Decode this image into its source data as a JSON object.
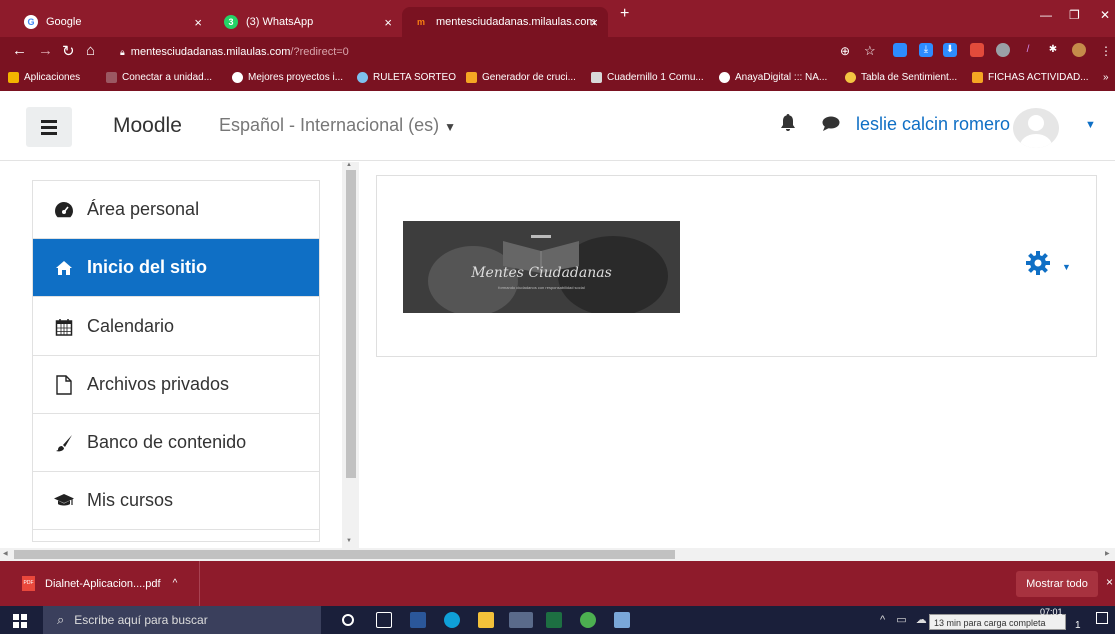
{
  "browser": {
    "tabs": [
      {
        "title": "Google",
        "favicon": "google-icon"
      },
      {
        "title": "(3) WhatsApp",
        "favicon": "whatsapp-icon",
        "badge": "3"
      },
      {
        "title": "mentesciudadanas.milaulas.com",
        "favicon": "moodle-icon",
        "active": true
      }
    ],
    "new_tab": "+",
    "url_host": "mentesciudadanas.milaulas.com",
    "url_path": "/?redirect=0",
    "bookmarks": [
      {
        "label": "Aplicaciones",
        "icon": "apps-icon"
      },
      {
        "label": "Conectar a unidad...",
        "icon": "drive-icon"
      },
      {
        "label": "Mejores proyectos i...",
        "icon": "globe-icon"
      },
      {
        "label": "RULETA SORTEO",
        "icon": "wheel-icon"
      },
      {
        "label": "Generador de cruci...",
        "icon": "pencil-icon"
      },
      {
        "label": "Cuadernillo 1 Comu...",
        "icon": "doc-icon"
      },
      {
        "label": "AnayaDigital ::: NA...",
        "icon": "globe-icon"
      },
      {
        "label": "Tabla de Sentimient...",
        "icon": "face-icon"
      },
      {
        "label": "FICHAS ACTIVIDAD...",
        "icon": "pencil-icon"
      }
    ],
    "bookmarks_more": "»"
  },
  "moodle": {
    "brand": "Moodle",
    "language": "Español - Internacional (es)",
    "user_name": "leslie calcin romero",
    "nav": [
      {
        "label": "Área personal",
        "icon": "dashboard-icon",
        "active": false
      },
      {
        "label": "Inicio del sitio",
        "icon": "home-icon",
        "active": true
      },
      {
        "label": "Calendario",
        "icon": "calendar-icon",
        "active": false
      },
      {
        "label": "Archivos privados",
        "icon": "file-icon",
        "active": false
      },
      {
        "label": "Banco de contenido",
        "icon": "brush-icon",
        "active": false
      },
      {
        "label": "Mis cursos",
        "icon": "graduation-cap-icon",
        "active": false
      }
    ],
    "logo_title": "Mentes Ciudadanas",
    "logo_tagline": "formando ciudadanos con responsabilidad social",
    "colors": {
      "accent": "#0f6fc5",
      "chrome": "#8e1b2b"
    }
  },
  "downloads": {
    "file": "Dialnet-Aplicacion....pdf",
    "chevron": "^",
    "show_all": "Mostrar todo",
    "close": "×"
  },
  "taskbar": {
    "search_placeholder": "Escribe aquí para buscar",
    "tooltip": "13 min para carga completa",
    "time": "07:01",
    "date_fragment": "1"
  }
}
